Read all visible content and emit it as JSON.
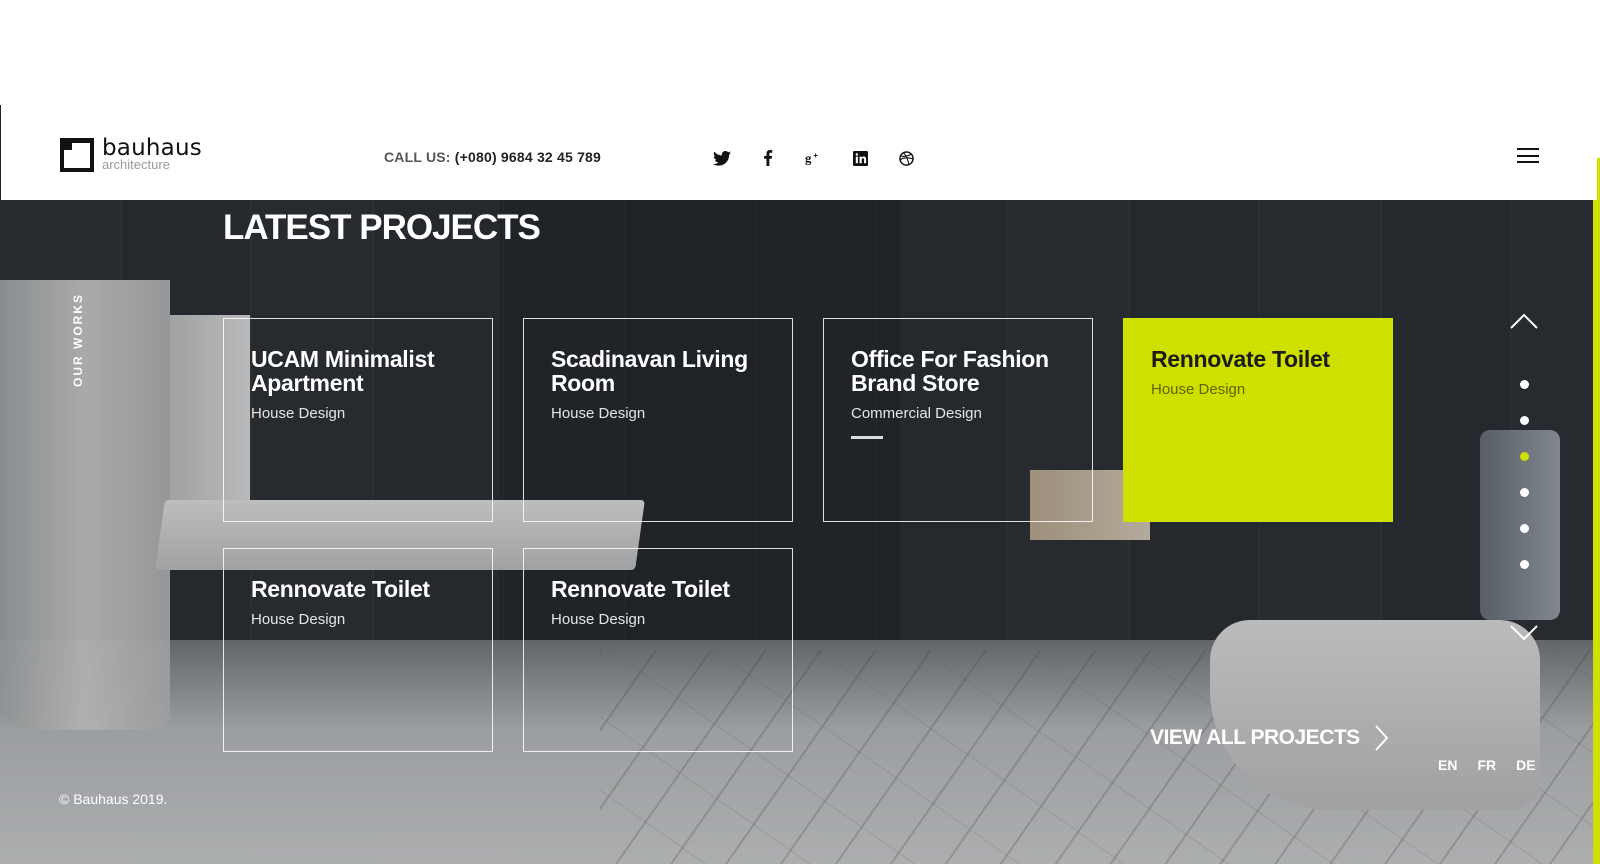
{
  "brand": {
    "name": "bauhaus",
    "tagline": "architecture"
  },
  "header": {
    "call_label": "CALL US:",
    "phone": "(+080) 9684 32 45 789",
    "social_icons": [
      "twitter-icon",
      "facebook-icon",
      "google-plus-icon",
      "linkedin-icon",
      "dribbble-icon"
    ]
  },
  "section": {
    "title": "LATEST PROJECTS",
    "side_label": "OUR WORKS"
  },
  "projects": [
    {
      "title": "UCAM Minimalist Apartment",
      "category": "House Design"
    },
    {
      "title": "Scadinavan Living Room",
      "category": "House Design"
    },
    {
      "title": "Office For Fashion Brand Store",
      "category": "Commercial Design"
    },
    {
      "title": "Rennovate Toilet",
      "category": "House Design"
    },
    {
      "title": "Rennovate Toilet",
      "category": "House Design"
    },
    {
      "title": "Rennovate Toilet",
      "category": "House Design"
    }
  ],
  "pager": {
    "count": 6,
    "active_index": 2
  },
  "view_all": "VIEW ALL PROJECTS",
  "languages": [
    "EN",
    "FR",
    "DE"
  ],
  "copyright": "© Bauhaus 2019.",
  "colors": {
    "accent": "#cfe000"
  }
}
